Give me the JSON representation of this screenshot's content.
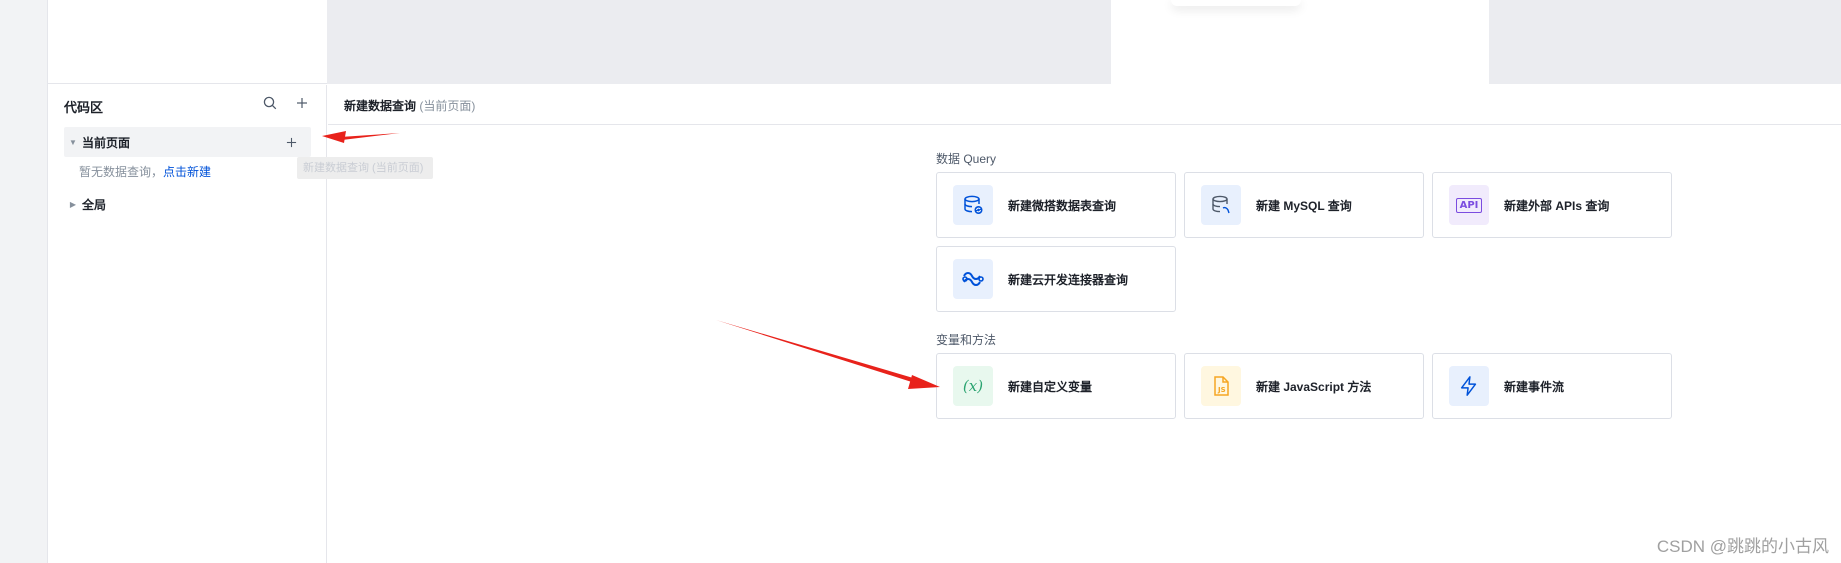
{
  "code_panel": {
    "title": "代码区",
    "tree": {
      "current_page": "当前页面",
      "empty_hint": "暂无数据查询，",
      "empty_link": "点击新建",
      "global": "全局"
    },
    "tooltip": "新建数据查询 (当前页面)"
  },
  "main": {
    "title": "新建数据查询",
    "title_sub": "(当前页面)",
    "sections": {
      "data_query": "数据 Query",
      "vars_methods": "变量和方法"
    },
    "cards": {
      "weida_query": "新建微搭数据表查询",
      "mysql_query": "新建 MySQL 查询",
      "external_api": "新建外部 APIs 查询",
      "cloud_connector": "新建云开发连接器查询",
      "custom_var": "新建自定义变量",
      "js_method": "新建 JavaScript 方法",
      "event_flow": "新建事件流"
    },
    "icon_texts": {
      "api": "API",
      "var": "(x)",
      "js": "JS"
    }
  },
  "watermark": "CSDN @跳跳的小古风",
  "colors": {
    "accent": "#0052d9",
    "arrow": "#e8221b",
    "var_icon_bg": "#e8f8ee",
    "var_icon": "#2ba471",
    "js_icon_bg": "#fff7e0",
    "js_icon": "#f5a623",
    "api_icon_bg": "#f1ebfc",
    "api_icon": "#7b4ce0",
    "db_icon_bg": "#e8f0fd"
  }
}
